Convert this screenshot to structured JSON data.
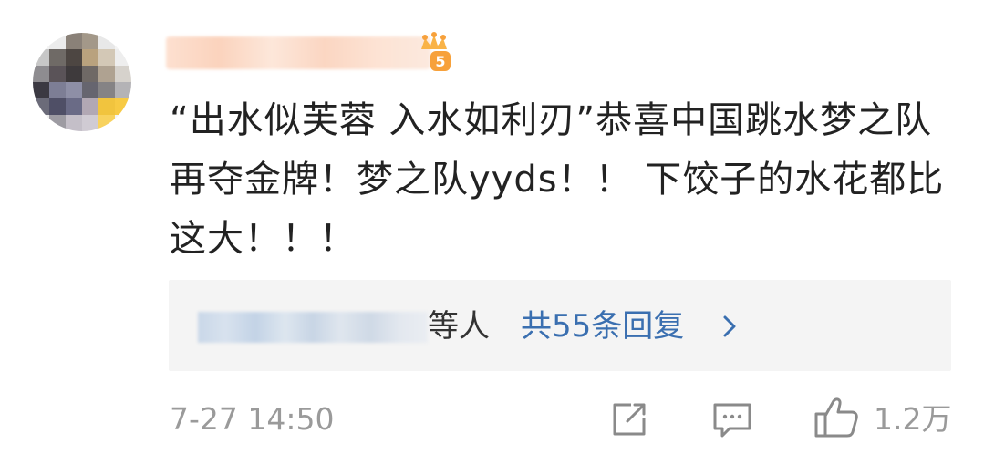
{
  "comment": {
    "text": "“出水似芙蓉 入水如利刃”恭喜中国跳水梦之队再夺金牌！梦之队yyds！！ 下饺子的水花都比这大！！！",
    "timestamp": "7-27 14:50"
  },
  "vip_badge": {
    "level": "5",
    "icon": "vip-crown-icon"
  },
  "replies": {
    "etc_label": "等人",
    "count_label": "共55条回复",
    "chevron_icon": "chevron-right-icon"
  },
  "actions": {
    "share_icon": "share-icon",
    "comment_icon": "comment-icon",
    "like_icon": "thumbs-up-icon",
    "like_count": "1.2万"
  },
  "colors": {
    "text": "#222222",
    "link": "#3a6fb0",
    "muted": "#9a9a9a",
    "reply_bg": "#f4f4f4",
    "badge": "#f7a13b"
  }
}
